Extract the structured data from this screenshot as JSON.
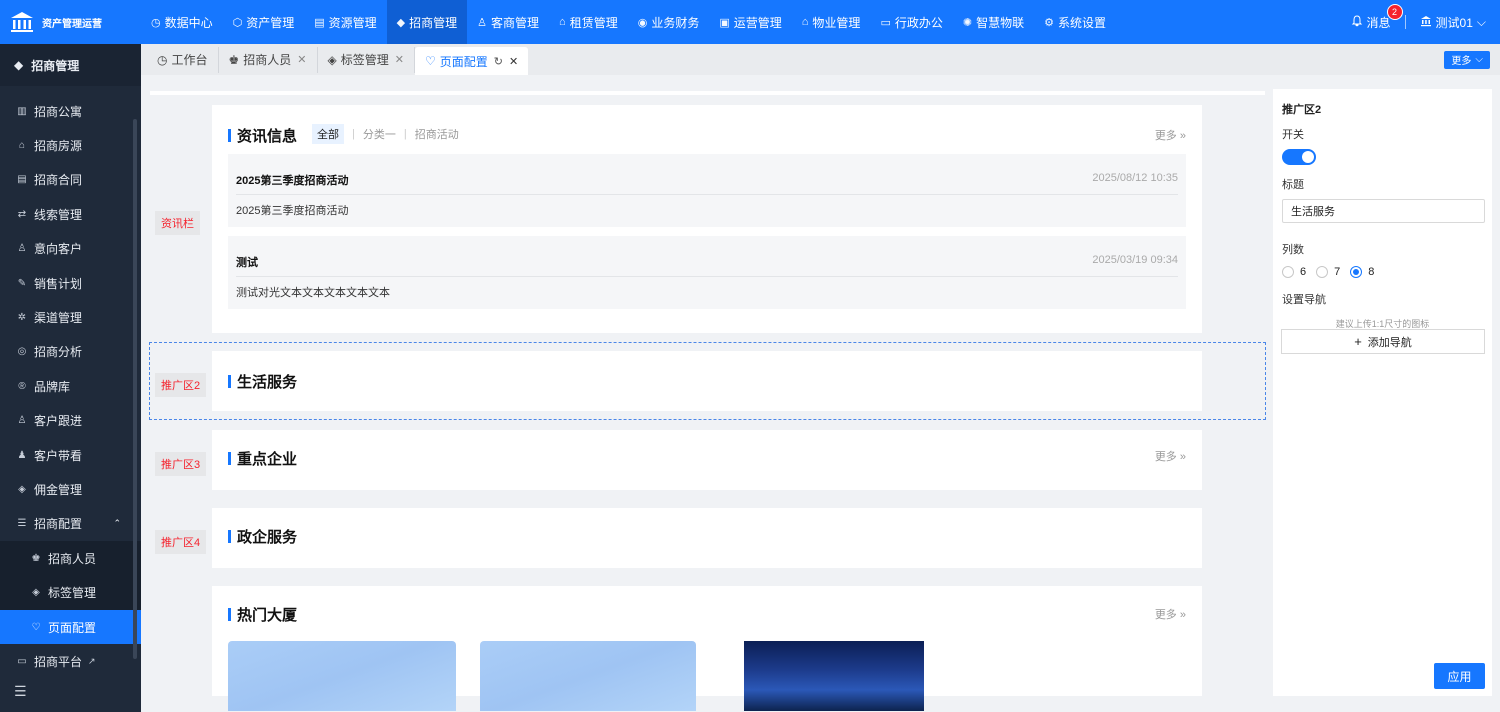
{
  "brand": {
    "title": "资产管理运营"
  },
  "topnav": [
    {
      "label": "数据中心",
      "icon": "◷"
    },
    {
      "label": "资产管理",
      "icon": "⬡"
    },
    {
      "label": "资源管理",
      "icon": "▤"
    },
    {
      "label": "招商管理",
      "icon": "◆"
    },
    {
      "label": "客商管理",
      "icon": "♙"
    },
    {
      "label": "租赁管理",
      "icon": "⌂"
    },
    {
      "label": "业务财务",
      "icon": "◉"
    },
    {
      "label": "运营管理",
      "icon": "▣"
    },
    {
      "label": "物业管理",
      "icon": "⌂"
    },
    {
      "label": "行政办公",
      "icon": "▭"
    },
    {
      "label": "智慧物联",
      "icon": "✺"
    },
    {
      "label": "系统设置",
      "icon": "⚙"
    }
  ],
  "header_right": {
    "messages_label": "消息",
    "messages_count": "2",
    "user_label": "测试01"
  },
  "sidebar": {
    "title": "招商管理",
    "items": [
      {
        "label": "招商公寓",
        "icon": "▥"
      },
      {
        "label": "招商房源",
        "icon": "⌂"
      },
      {
        "label": "招商合同",
        "icon": "▤"
      },
      {
        "label": "线索管理",
        "icon": "⇄"
      },
      {
        "label": "意向客户",
        "icon": "♙"
      },
      {
        "label": "销售计划",
        "icon": "✎"
      },
      {
        "label": "渠道管理",
        "icon": "✲"
      },
      {
        "label": "招商分析",
        "icon": "◎"
      },
      {
        "label": "品牌库",
        "icon": "®"
      },
      {
        "label": "客户跟进",
        "icon": "♙"
      },
      {
        "label": "客户带看",
        "icon": "♟"
      },
      {
        "label": "佣金管理",
        "icon": "◈"
      },
      {
        "label": "招商配置",
        "icon": "☰"
      }
    ],
    "sub_items": [
      {
        "label": "招商人员",
        "icon": "♚"
      },
      {
        "label": "标签管理",
        "icon": "◈"
      },
      {
        "label": "页面配置",
        "icon": "♡"
      }
    ],
    "platform": {
      "label": "招商平台",
      "icon": "▭"
    }
  },
  "tabs": [
    {
      "label": "工作台",
      "icon": "◷"
    },
    {
      "label": "招商人员",
      "icon": "♚"
    },
    {
      "label": "标签管理",
      "icon": "◈"
    },
    {
      "label": "页面配置",
      "icon": "♡"
    }
  ],
  "tabbar": {
    "more_label": "更多"
  },
  "canvas": {
    "labels": {
      "news": "资讯栏",
      "promo2": "推广区2",
      "promo3": "推广区3",
      "promo4": "推广区4"
    },
    "news_card": {
      "title": "资讯信息",
      "filters": [
        "全部",
        "分类一",
        "招商活动"
      ],
      "more": "更多 »",
      "items": [
        {
          "title": "2025第三季度招商活动",
          "date": "2025/08/12 10:35",
          "body": "2025第三季度招商活动"
        },
        {
          "title": "测试",
          "date": "2025/03/19 09:34",
          "body": "测试对光文本文本文本文本文本"
        }
      ]
    },
    "promo2": {
      "title": "生活服务"
    },
    "promo3": {
      "title": "重点企业",
      "more": "更多 »"
    },
    "promo4": {
      "title": "政企服务"
    },
    "hot": {
      "title": "热门大厦",
      "more": "更多 »"
    }
  },
  "panel": {
    "title": "推广区2",
    "switch_label": "开关",
    "switch_on": true,
    "title_label": "标题",
    "title_value": "生活服务",
    "columns_label": "列数",
    "columns_options": [
      "6",
      "7",
      "8"
    ],
    "columns_selected": "8",
    "nav_label": "设置导航",
    "nav_hint": "建议上传1:1尺寸的图标",
    "add_nav": "添加导航",
    "apply": "应用"
  }
}
